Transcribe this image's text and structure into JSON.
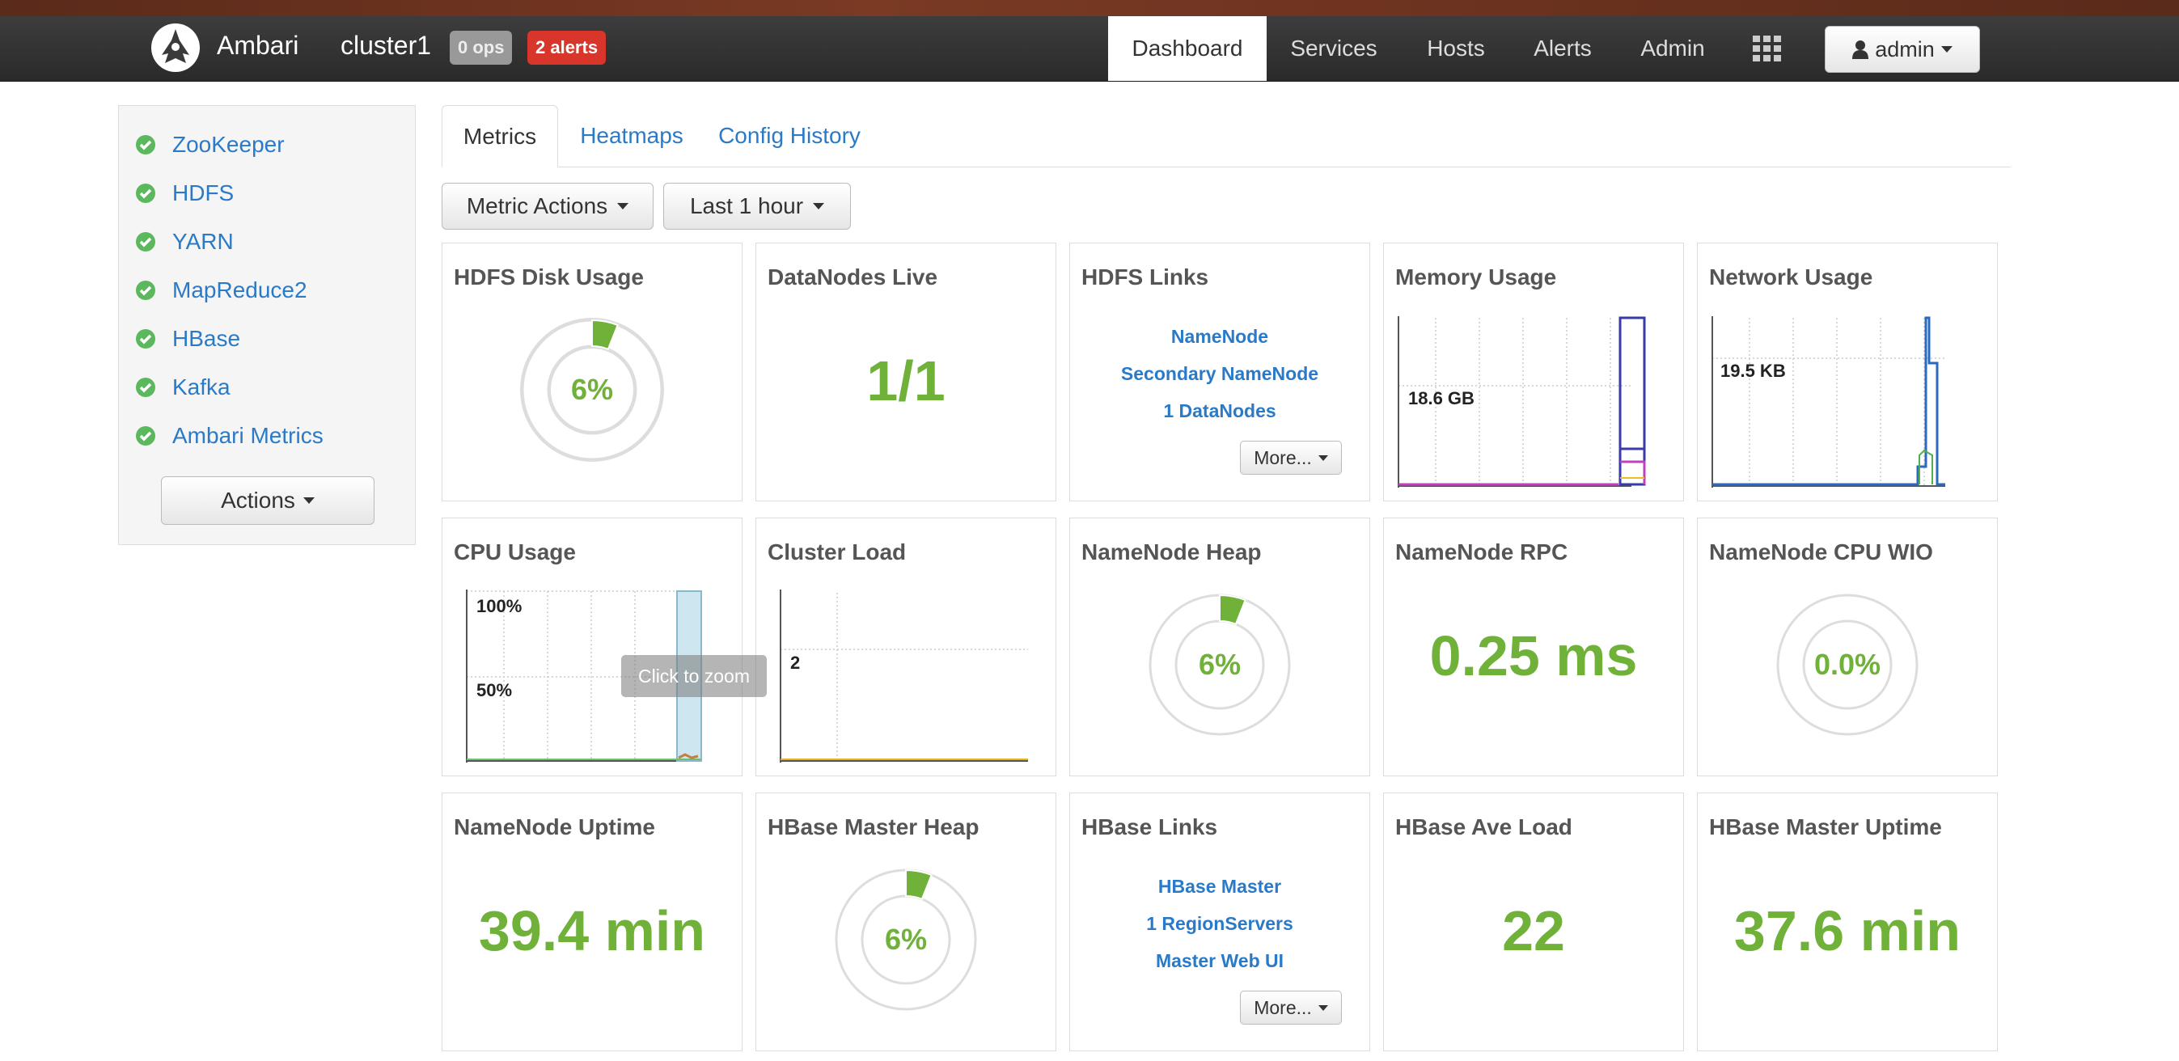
{
  "navbar": {
    "brand": "Ambari",
    "cluster": "cluster1",
    "ops_badge": "0 ops",
    "alerts_badge": "2 alerts",
    "items": [
      {
        "label": "Dashboard",
        "active": true
      },
      {
        "label": "Services"
      },
      {
        "label": "Hosts"
      },
      {
        "label": "Alerts"
      },
      {
        "label": "Admin"
      }
    ],
    "apps_icon": "grid-icon",
    "user": "admin",
    "user_icon": "user-icon"
  },
  "sidebar": {
    "services": [
      {
        "label": "ZooKeeper",
        "status": "ok"
      },
      {
        "label": "HDFS",
        "status": "ok"
      },
      {
        "label": "YARN",
        "status": "ok"
      },
      {
        "label": "MapReduce2",
        "status": "ok"
      },
      {
        "label": "HBase",
        "status": "ok"
      },
      {
        "label": "Kafka",
        "status": "ok"
      },
      {
        "label": "Ambari Metrics",
        "status": "ok"
      }
    ],
    "actions_label": "Actions"
  },
  "tabs": [
    {
      "label": "Metrics",
      "active": true
    },
    {
      "label": "Heatmaps"
    },
    {
      "label": "Config History"
    }
  ],
  "toolbar": {
    "metric_actions": "Metric Actions",
    "time_range": "Last 1 hour"
  },
  "colors": {
    "accent_green": "#70b13a",
    "link_blue": "#2a7ac7",
    "alert_red": "#d9362b"
  },
  "widgets": {
    "hdfs_disk_usage": {
      "title": "HDFS Disk Usage",
      "value": "6%",
      "percent": 6
    },
    "datanodes_live": {
      "title": "DataNodes Live",
      "value": "1/1"
    },
    "hdfs_links": {
      "title": "HDFS Links",
      "links": [
        "NameNode",
        "Secondary NameNode",
        "1 DataNodes"
      ],
      "more": "More..."
    },
    "memory_usage": {
      "title": "Memory Usage",
      "label": "18.6 GB"
    },
    "network_usage": {
      "title": "Network Usage",
      "label": "19.5 KB"
    },
    "cpu_usage": {
      "title": "CPU Usage",
      "label_top": "100%",
      "label_mid": "50%"
    },
    "cluster_load": {
      "title": "Cluster Load",
      "label": "2"
    },
    "namenode_heap": {
      "title": "NameNode Heap",
      "value": "6%",
      "percent": 6
    },
    "namenode_rpc": {
      "title": "NameNode RPC",
      "value": "0.25 ms"
    },
    "namenode_cpu_wio": {
      "title": "NameNode CPU WIO",
      "value": "0.0%",
      "percent": 0
    },
    "namenode_uptime": {
      "title": "NameNode Uptime",
      "value": "39.4 min"
    },
    "hbase_master_heap": {
      "title": "HBase Master Heap",
      "value": "6%",
      "percent": 6
    },
    "hbase_links": {
      "title": "HBase Links",
      "links": [
        "HBase Master",
        "1 RegionServers",
        "Master Web UI"
      ],
      "more": "More..."
    },
    "hbase_ave_load": {
      "title": "HBase Ave Load",
      "value": "22"
    },
    "hbase_master_uptime": {
      "title": "HBase Master Uptime",
      "value": "37.6 min"
    }
  },
  "tooltip": "Click to zoom"
}
